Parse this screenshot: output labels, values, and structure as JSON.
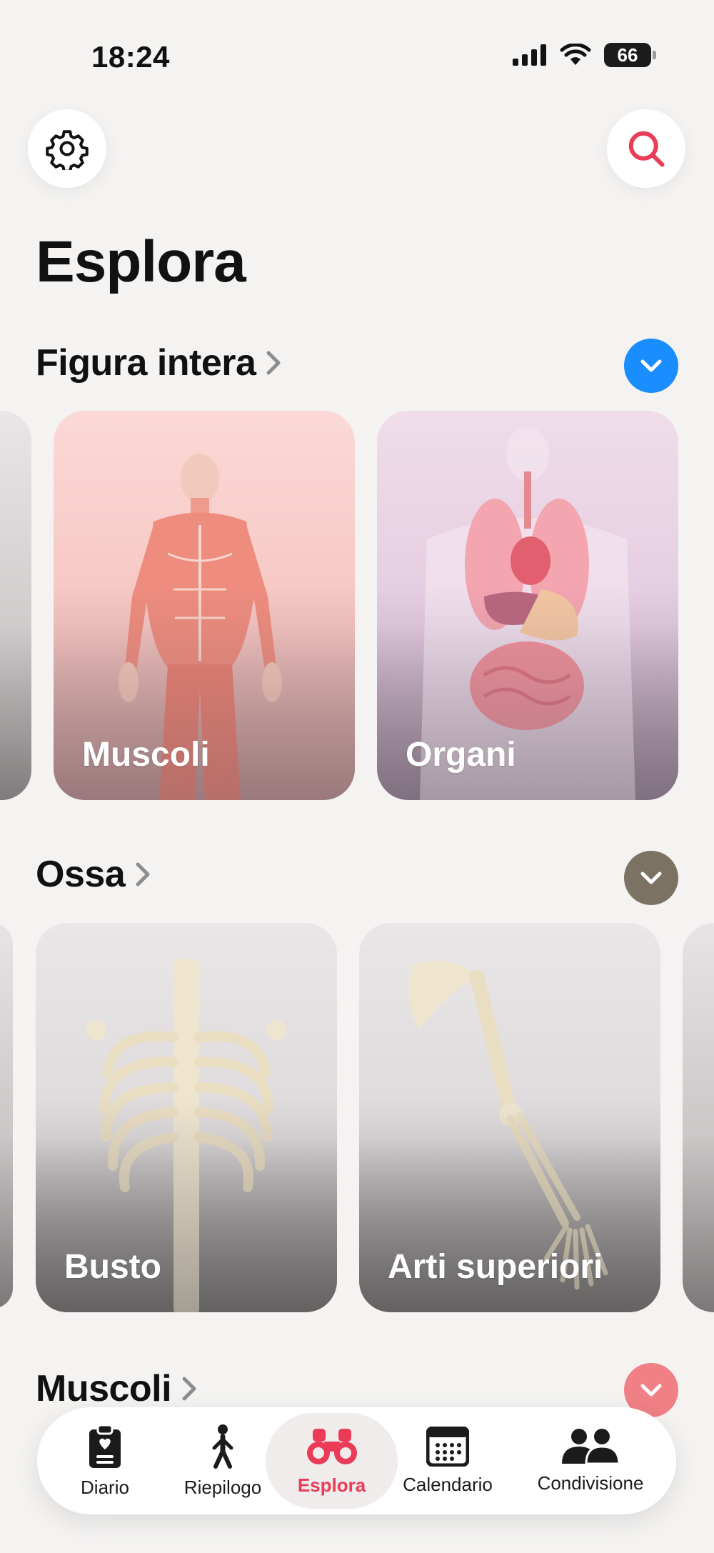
{
  "status_bar": {
    "time": "18:24",
    "battery": "66"
  },
  "page": {
    "title": "Esplora"
  },
  "sections": [
    {
      "title": "Figura intera",
      "toggle_color": "#1a8dff",
      "cards": [
        {
          "label": "Muscoli"
        },
        {
          "label": "Organi"
        }
      ]
    },
    {
      "title": "Ossa",
      "toggle_color": "#7b7263",
      "cards": [
        {
          "label": "Busto"
        },
        {
          "label": "Arti superiori"
        }
      ]
    },
    {
      "title": "Muscoli",
      "toggle_color": "#f07f86"
    }
  ],
  "nav": {
    "items": [
      {
        "label": "Diario",
        "icon": "clipboard-heart-icon"
      },
      {
        "label": "Riepilogo",
        "icon": "walking-person-icon"
      },
      {
        "label": "Esplora",
        "icon": "binoculars-icon",
        "active": true
      },
      {
        "label": "Calendario",
        "icon": "calendar-icon"
      },
      {
        "label": "Condivisione",
        "icon": "people-icon"
      }
    ],
    "active_color": "#ea3b57"
  }
}
